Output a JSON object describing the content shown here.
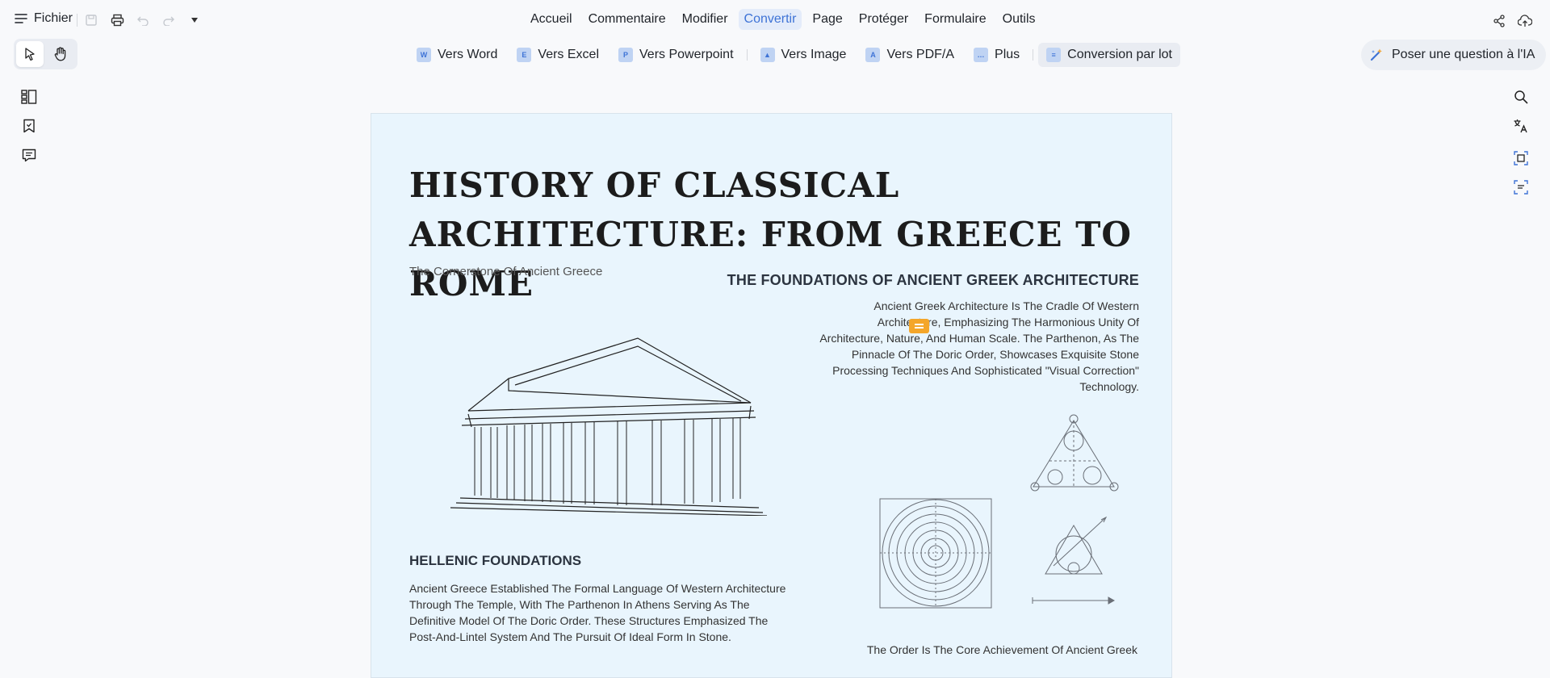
{
  "menubar": {
    "file_label": "Fichier",
    "items": [
      "Accueil",
      "Commentaire",
      "Modifier",
      "Convertir",
      "Page",
      "Protéger",
      "Formulaire",
      "Outils"
    ],
    "active_item": "Convertir"
  },
  "convert_toolbar": {
    "items": [
      {
        "label": "Vers Word",
        "glyph": "W"
      },
      {
        "label": "Vers Excel",
        "glyph": "E"
      },
      {
        "label": "Vers Powerpoint",
        "glyph": "P"
      },
      {
        "label": "Vers Image",
        "glyph": "▲"
      },
      {
        "label": "Vers PDF/A",
        "glyph": "A"
      },
      {
        "label": "Plus",
        "glyph": "…"
      },
      {
        "label": "Conversion par lot",
        "glyph": "≡"
      }
    ]
  },
  "ai": {
    "label": "Poser une question à l'IA"
  },
  "document": {
    "title": "HISTORY OF CLASSICAL  ARCHITECTURE: FROM GREECE TO ROME",
    "subheading_left": "The Cornerstone Of Ancient Greece",
    "right_heading": "THE FOUNDATIONS OF ANCIENT GREEK ARCHITECTURE",
    "right_paragraph": "Ancient Greek Architecture Is The Cradle Of Western Architecture, Emphasizing The Harmonious Unity Of Architecture, Nature, And Human Scale. The Parthenon, As The Pinnacle Of The Doric Order, Showcases Exquisite Stone Processing Techniques And Sophisticated \"Visual Correction\" Technology.",
    "hellenic_heading": "HELLENIC FOUNDATIONS",
    "hellenic_paragraph": "Ancient Greece Established The Formal Language Of Western Architecture Through The Temple, With The Parthenon In Athens Serving As The Definitive Model Of The Doric Order. These Structures Emphasized The Post-And-Lintel System And The Pursuit Of Ideal Form In Stone.",
    "bottom_line": "The Order Is The Core Achievement Of Ancient Greek"
  },
  "colors": {
    "accent": "#3e73d6",
    "page_bg": "#e9f5fd",
    "note": "#f4a62a"
  }
}
